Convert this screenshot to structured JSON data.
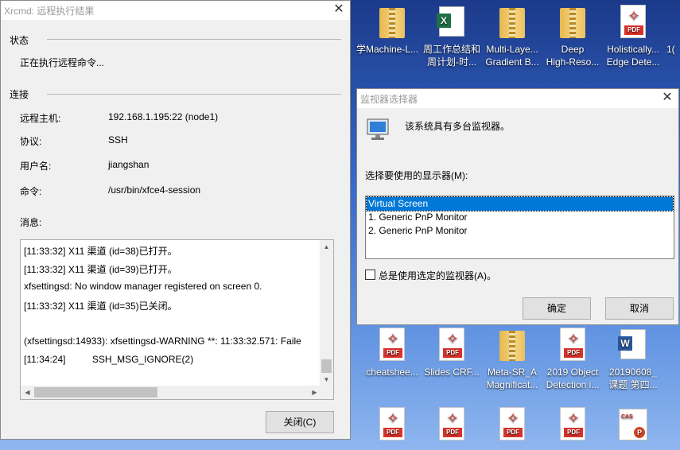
{
  "desktop": {
    "top_row": [
      {
        "label1": "学",
        "label2": "",
        "type": "partial"
      },
      {
        "label1": "Machine-L...",
        "label2": "",
        "type": "folder"
      },
      {
        "label1": "周工作总结和",
        "label2": "周计划-时...",
        "type": "xls"
      },
      {
        "label1": "Multi-Laye...",
        "label2": "Gradient B...",
        "type": "folder"
      },
      {
        "label1": "Deep",
        "label2": "High-Reso...",
        "type": "folder"
      },
      {
        "label1": "Holistically...",
        "label2": "Edge Dete...",
        "type": "pdf"
      },
      {
        "label1": "1(",
        "label2": "",
        "type": "partial"
      }
    ],
    "middle_row": [
      {
        "label1": "cheatshee...",
        "type": "pdf"
      },
      {
        "label1": "Slides CRF...",
        "type": "pdf"
      },
      {
        "label1": "Meta-SR_A",
        "label2": "Magnificat...",
        "type": "folder"
      },
      {
        "label1": "2019 Object",
        "label2": "Detection i...",
        "type": "pdf"
      },
      {
        "label1": "20190608_",
        "label2": "课题 第四...",
        "type": "doc"
      }
    ],
    "pdf_tag": "PDF",
    "xls_letter": "X",
    "doc_letter": "W",
    "ppt_tag": "CAS",
    "ppt_letter": "P"
  },
  "xrcmd": {
    "title": "Xrcmd: 远程执行结果",
    "status_header": "状态",
    "status_text": "正在执行远程命令...",
    "connection_header": "连接",
    "host_label": "远程主机:",
    "host_value": "192.168.1.195:22 (node1)",
    "protocol_label": "协议:",
    "protocol_value": "SSH",
    "user_label": "用户名:",
    "user_value": "jiangshan",
    "command_label": "命令:",
    "command_value": "/usr/bin/xfce4-session",
    "messages_label": "消息:",
    "messages": [
      "[11:33:32] X11 渠道 (id=38)已打开。",
      "[11:33:32] X11 渠道 (id=39)已打开。",
      "xfsettingsd: No window manager registered on screen 0.",
      "[11:33:32] X11 渠道 (id=35)已关闭。",
      "",
      "(xfsettingsd:14933): xfsettingsd-WARNING **: 11:33:32.571: Faile",
      "[11:34:24]          SSH_MSG_IGNORE(2)"
    ],
    "close_button": "关闭(C)"
  },
  "monitor_selector": {
    "title": "监视器选择器",
    "message": "该系统具有多台监视器。",
    "select_label": "选择要使用的显示器(M):",
    "options": [
      "Virtual Screen",
      "1. Generic PnP Monitor",
      "2. Generic PnP Monitor"
    ],
    "selected_index": 0,
    "checkbox_label": "总是使用选定的监视器(A)。",
    "checkbox_checked": false,
    "ok_button": "确定",
    "cancel_button": "取消"
  },
  "colors": {
    "selection": "#0078d7",
    "pdf": "#d9322b"
  }
}
